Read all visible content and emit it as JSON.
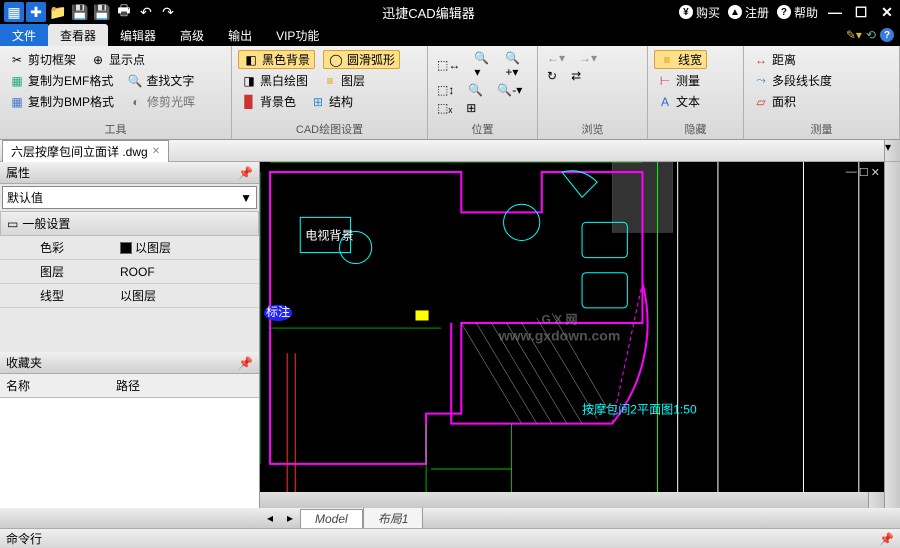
{
  "title": "迅捷CAD编辑器",
  "titlebar_right": {
    "buy": "购买",
    "register": "注册",
    "help": "帮助"
  },
  "menu": {
    "file": "文件",
    "viewer": "查看器",
    "editor": "编辑器",
    "advanced": "高级",
    "output": "输出",
    "vip": "VIP功能"
  },
  "ribbon": {
    "tools": {
      "title": "工具",
      "crop": "剪切框架",
      "emf": "复制为EMF格式",
      "bmp": "复制为BMP格式",
      "point": "显示点",
      "find": "查找文字",
      "halo": "修剪光晖"
    },
    "cad": {
      "title": "CAD绘图设置",
      "black": "黑色背景",
      "smooth": "圆滑弧形",
      "bw": "黑白绘图",
      "layer": "图层",
      "bgcolor": "背景色",
      "struct": "结构"
    },
    "pos": {
      "title": "位置"
    },
    "browse": {
      "title": "浏览"
    },
    "hide": {
      "title": "隐藏",
      "linew": "线宽",
      "measure": "测量",
      "text": "文本"
    },
    "meas": {
      "title": "测量",
      "dist": "距离",
      "poly": "多段线长度",
      "area": "面积"
    }
  },
  "file_tab": "六层按摩包间立面详 .dwg",
  "props": {
    "title": "属性",
    "default": "默认值",
    "general": "一般设置",
    "color_l": "色彩",
    "color_v": "以图层",
    "layer_l": "图层",
    "layer_v": "ROOF",
    "ltype_l": "线型",
    "ltype_v": "以图层"
  },
  "fav": {
    "title": "收藏夹",
    "name": "名称",
    "path": "路径"
  },
  "bottom": {
    "model": "Model",
    "layout": "布局1"
  },
  "cmd": "命令行",
  "watermark": {
    "l1": "G X 网",
    "l2": "www.gxdown.com"
  },
  "canvas_label": "按摩包间2平面图1:50"
}
